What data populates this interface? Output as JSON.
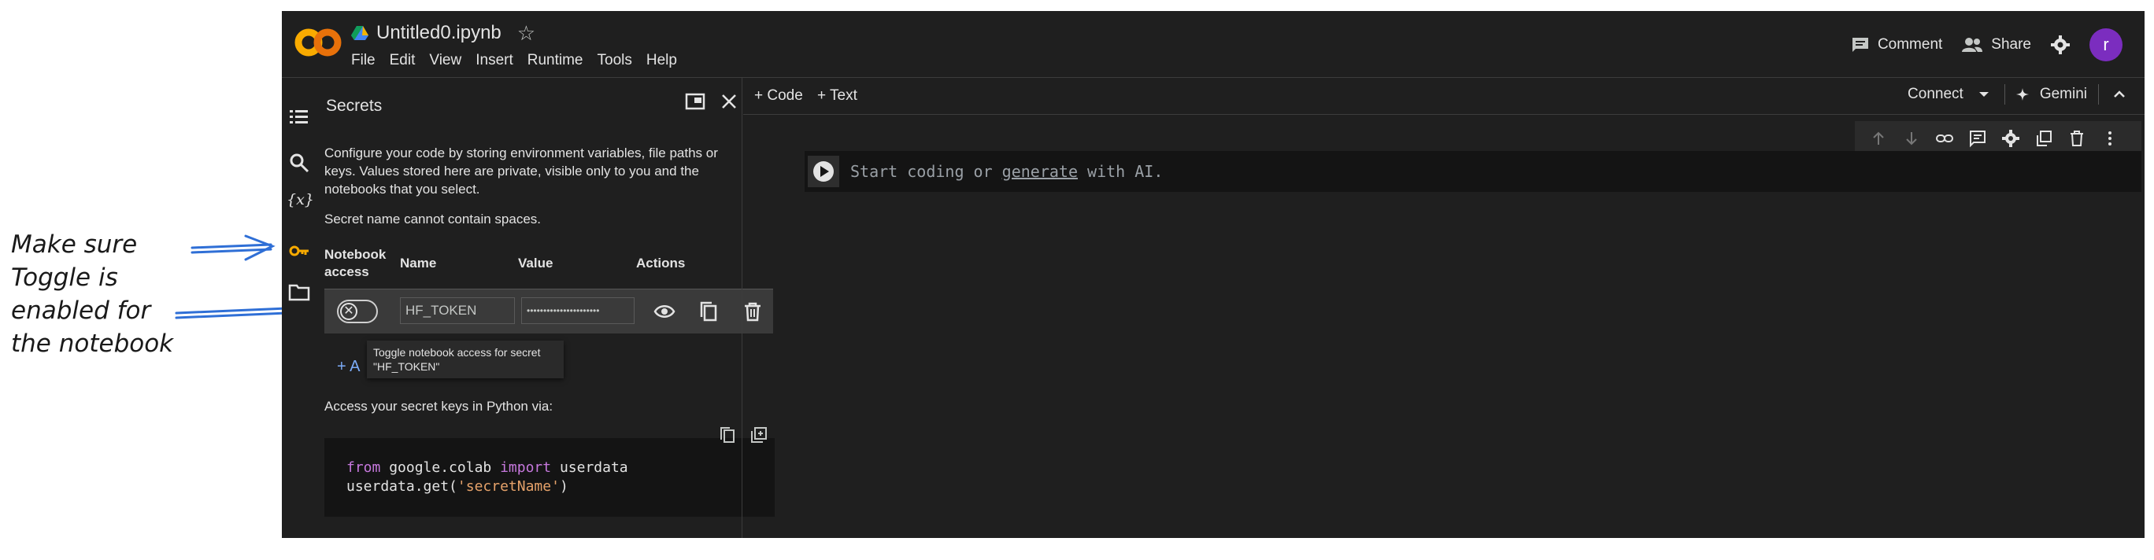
{
  "annotation": {
    "lines": [
      "Make sure",
      "Toggle is",
      "enabled for",
      "the notebook"
    ],
    "color": "#2f6fd6"
  },
  "header": {
    "logo": "CO",
    "notebook_title": "Untitled0.ipynb",
    "menu": [
      "File",
      "Edit",
      "View",
      "Insert",
      "Runtime",
      "Tools",
      "Help"
    ],
    "comment_label": "Comment",
    "share_label": "Share",
    "avatar_letter": "r",
    "avatar_color": "#7b2dbf"
  },
  "secrets_panel": {
    "title": "Secrets",
    "description": "Configure your code by storing environment variables, file paths or keys. Values stored here are private, visible only to you and the notebooks that you select.",
    "name_rule": "Secret name cannot contain spaces.",
    "columns": {
      "notebook_access": "Notebook access",
      "name": "Name",
      "value": "Value",
      "actions": "Actions"
    },
    "rows": [
      {
        "name": "HF_TOKEN",
        "value_masked": "••••••••••••••••••••••",
        "access_enabled": false
      }
    ],
    "tooltip": "Toggle notebook access for secret \"HF_TOKEN\"",
    "add_new_label": "+ A",
    "access_hint": "Access your secret keys in Python via:",
    "code": {
      "line1_kw1": "from",
      "line1_mid": " google.colab ",
      "line1_kw2": "import",
      "line1_end": " userdata",
      "line2_start": "userdata.get(",
      "line2_str": "'secretName'",
      "line2_end": ")"
    }
  },
  "main": {
    "add_code_label": "+ Code",
    "add_text_label": "+ Text",
    "connect_label": "Connect",
    "gemini_label": "Gemini",
    "cell_placeholder_start": "Start coding or ",
    "cell_placeholder_link": "generate",
    "cell_placeholder_end": " with AI."
  }
}
